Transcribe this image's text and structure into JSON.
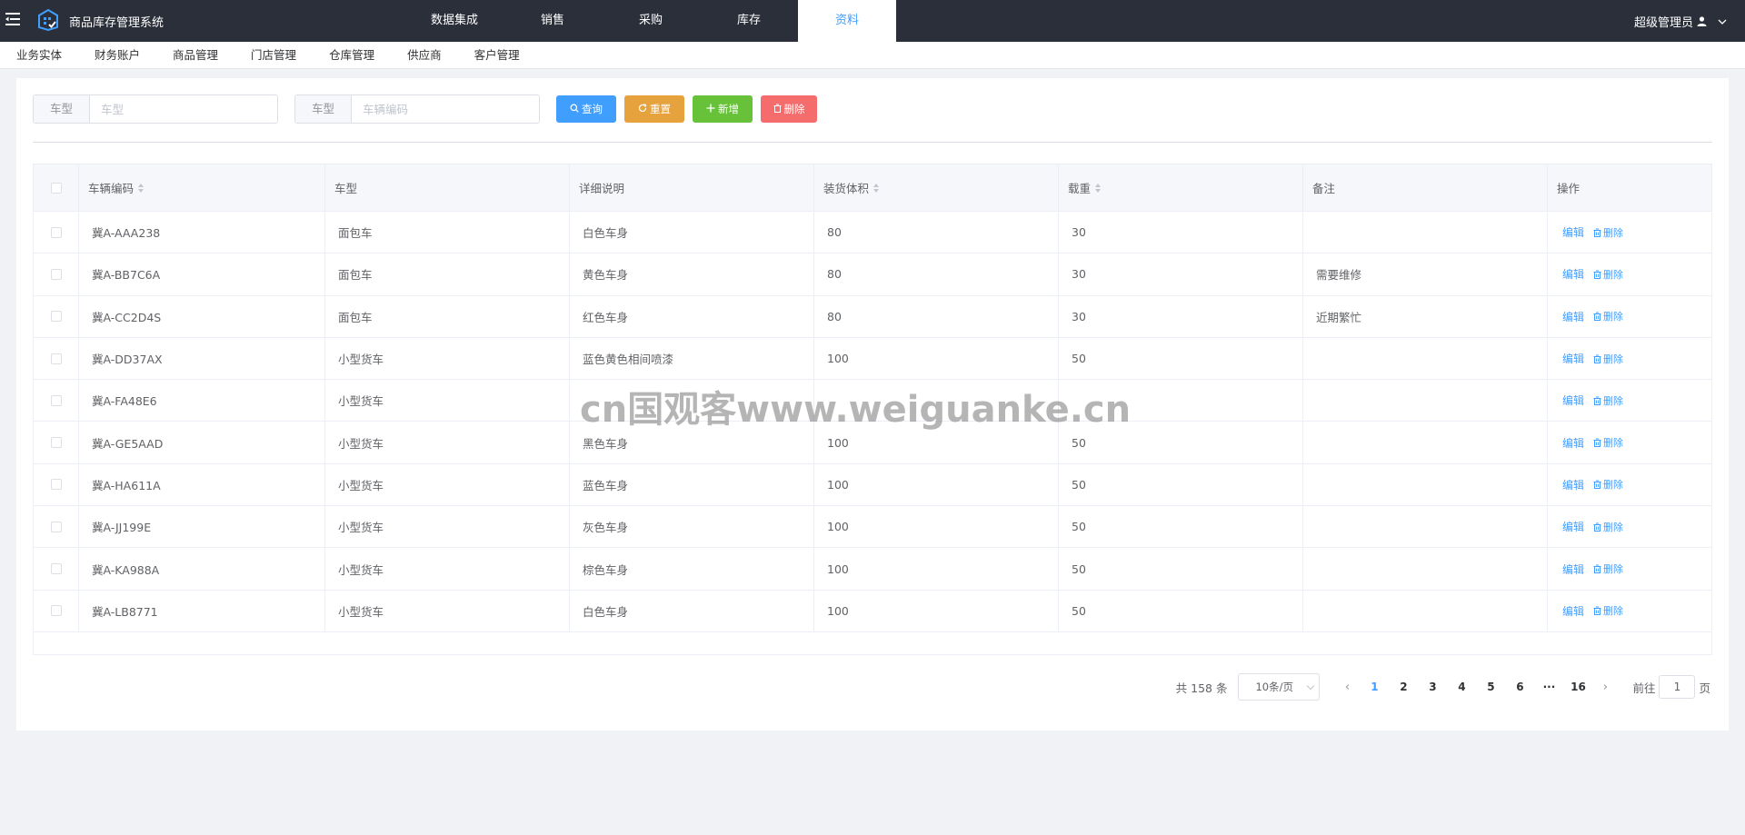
{
  "app": {
    "title": "商品库存管理系统"
  },
  "nav": {
    "items": [
      {
        "label": "数据集成"
      },
      {
        "label": "销售"
      },
      {
        "label": "采购"
      },
      {
        "label": "库存"
      },
      {
        "label": "资料",
        "active": true
      }
    ]
  },
  "user": {
    "name": "超级管理员"
  },
  "subnav": {
    "items": [
      {
        "label": "业务实体"
      },
      {
        "label": "财务账户"
      },
      {
        "label": "商品管理"
      },
      {
        "label": "门店管理"
      },
      {
        "label": "仓库管理"
      },
      {
        "label": "供应商"
      },
      {
        "label": "客户管理"
      }
    ]
  },
  "filters": {
    "type": {
      "label": "车型",
      "placeholder": "车型",
      "value": ""
    },
    "code": {
      "label": "车型",
      "placeholder": "车辆编码",
      "value": ""
    }
  },
  "buttons": {
    "query": "查询",
    "reset": "重置",
    "add": "新增",
    "delete": "删除"
  },
  "table": {
    "headers": {
      "code": "车辆编码",
      "type": "车型",
      "desc": "详细说明",
      "volume": "装货体积",
      "load": "载重",
      "note": "备注",
      "ops": "操作"
    },
    "actions": {
      "edit": "编辑",
      "delete": "删除"
    },
    "rows": [
      {
        "code": "冀A-AAA238",
        "type": "面包车",
        "desc": "白色车身",
        "volume": "80",
        "load": "30",
        "note": ""
      },
      {
        "code": "冀A-BB7C6A",
        "type": "面包车",
        "desc": "黄色车身",
        "volume": "80",
        "load": "30",
        "note": "需要维修"
      },
      {
        "code": "冀A-CC2D4S",
        "type": "面包车",
        "desc": "红色车身",
        "volume": "80",
        "load": "30",
        "note": "近期繁忙"
      },
      {
        "code": "冀A-DD37AX",
        "type": "小型货车",
        "desc": "蓝色黄色相间喷漆",
        "volume": "100",
        "load": "50",
        "note": ""
      },
      {
        "code": "冀A-FA48E6",
        "type": "小型货车",
        "desc": "",
        "volume": "",
        "load": "",
        "note": ""
      },
      {
        "code": "冀A-GE5AAD",
        "type": "小型货车",
        "desc": "黑色车身",
        "volume": "100",
        "load": "50",
        "note": ""
      },
      {
        "code": "冀A-HA611A",
        "type": "小型货车",
        "desc": "蓝色车身",
        "volume": "100",
        "load": "50",
        "note": ""
      },
      {
        "code": "冀A-JJ199E",
        "type": "小型货车",
        "desc": "灰色车身",
        "volume": "100",
        "load": "50",
        "note": ""
      },
      {
        "code": "冀A-KA988A",
        "type": "小型货车",
        "desc": "棕色车身",
        "volume": "100",
        "load": "50",
        "note": ""
      },
      {
        "code": "冀A-LB8771",
        "type": "小型货车",
        "desc": "白色车身",
        "volume": "100",
        "load": "50",
        "note": ""
      }
    ]
  },
  "pagination": {
    "total": "共 158 条",
    "page_size": "10条/页",
    "pages": [
      "1",
      "2",
      "3",
      "4",
      "5",
      "6",
      "···",
      "16"
    ],
    "current": "1",
    "goto_prefix": "前往",
    "goto_value": "1",
    "goto_suffix": "页"
  },
  "watermark": "cn国观客www.weiguanke.cn",
  "colors": {
    "topbar": "#2b2f3a",
    "primary": "#409eff",
    "warning": "#e6a23c",
    "success": "#67c23a",
    "danger": "#f56c6c"
  }
}
